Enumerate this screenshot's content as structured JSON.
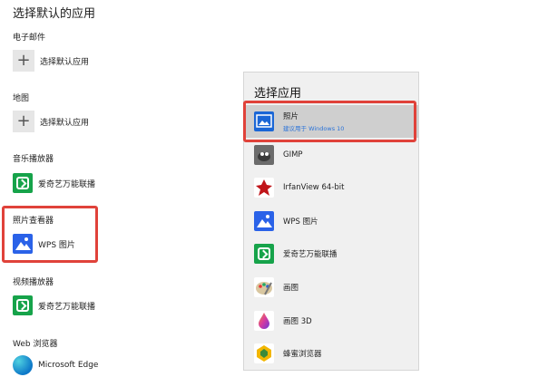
{
  "page": {
    "title": "选择默认的应用"
  },
  "sections": [
    {
      "label": "电子邮件",
      "app": "选择默认应用",
      "icon": "plus-icon"
    },
    {
      "label": "地图",
      "app": "选择默认应用",
      "icon": "plus-icon"
    },
    {
      "label": "音乐播放器",
      "app": "爱奇艺万能联播",
      "icon": "iqiyi-icon"
    },
    {
      "label": "照片查看器",
      "app": "WPS 图片",
      "icon": "wps-image-icon"
    },
    {
      "label": "视频播放器",
      "app": "爱奇艺万能联播",
      "icon": "iqiyi-icon"
    },
    {
      "label": "Web 浏览器",
      "app": "Microsoft Edge",
      "icon": "edge-icon"
    }
  ],
  "flyout": {
    "title": "选择应用",
    "items": [
      {
        "name": "照片",
        "sub": "建议用于 Windows 10",
        "icon": "photos-icon"
      },
      {
        "name": "GIMP",
        "icon": "gimp-icon"
      },
      {
        "name": "IrfanView 64-bit",
        "icon": "irfanview-icon"
      },
      {
        "name": "WPS 图片",
        "icon": "wps-image-icon"
      },
      {
        "name": "爱奇艺万能联播",
        "icon": "iqiyi-icon"
      },
      {
        "name": "画图",
        "icon": "paint-icon"
      },
      {
        "name": "画图 3D",
        "icon": "paint3d-icon"
      },
      {
        "name": "蜂蜜浏览器",
        "icon": "honey-browser-icon"
      }
    ]
  },
  "colors": {
    "highlight": "#e0423a",
    "accent": "#2b73d8"
  }
}
